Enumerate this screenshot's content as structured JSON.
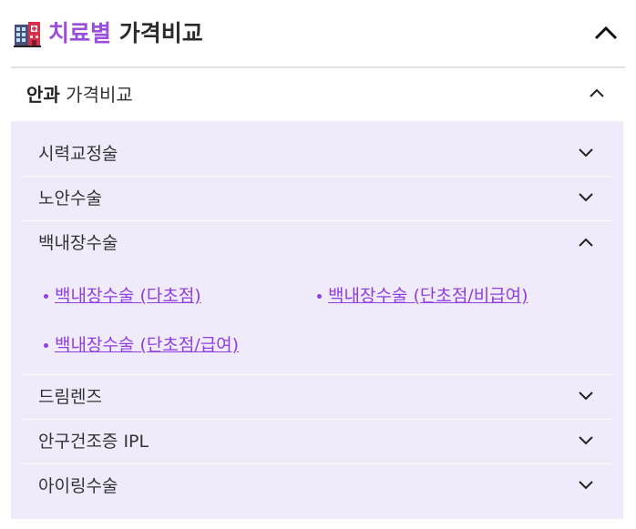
{
  "header": {
    "title_accent": "치료별",
    "title_rest": "가격비교",
    "icon": "hospital-icon",
    "toggle": "chevron-up-icon"
  },
  "section": {
    "title_bold": "안과",
    "title_light": "가격비교",
    "toggle": "chevron-up-icon"
  },
  "items": [
    {
      "label": "시력교정술",
      "state": "collapsed"
    },
    {
      "label": "노안수술",
      "state": "collapsed"
    },
    {
      "label": "백내장수술",
      "state": "expanded"
    },
    {
      "label": "드림렌즈",
      "state": "collapsed"
    },
    {
      "label": "안구건조증 IPL",
      "state": "collapsed"
    },
    {
      "label": "아이링수술",
      "state": "collapsed"
    }
  ],
  "cataract_links": [
    "백내장수술 (다초점)",
    "백내장수술 (단초점/비급여)",
    "백내장수술 (단초점/급여)"
  ],
  "colors": {
    "accent": "#9b4ddc",
    "link": "#8f3fe0",
    "panel_bg": "#efebfb",
    "divider": "#e2e2e2"
  }
}
